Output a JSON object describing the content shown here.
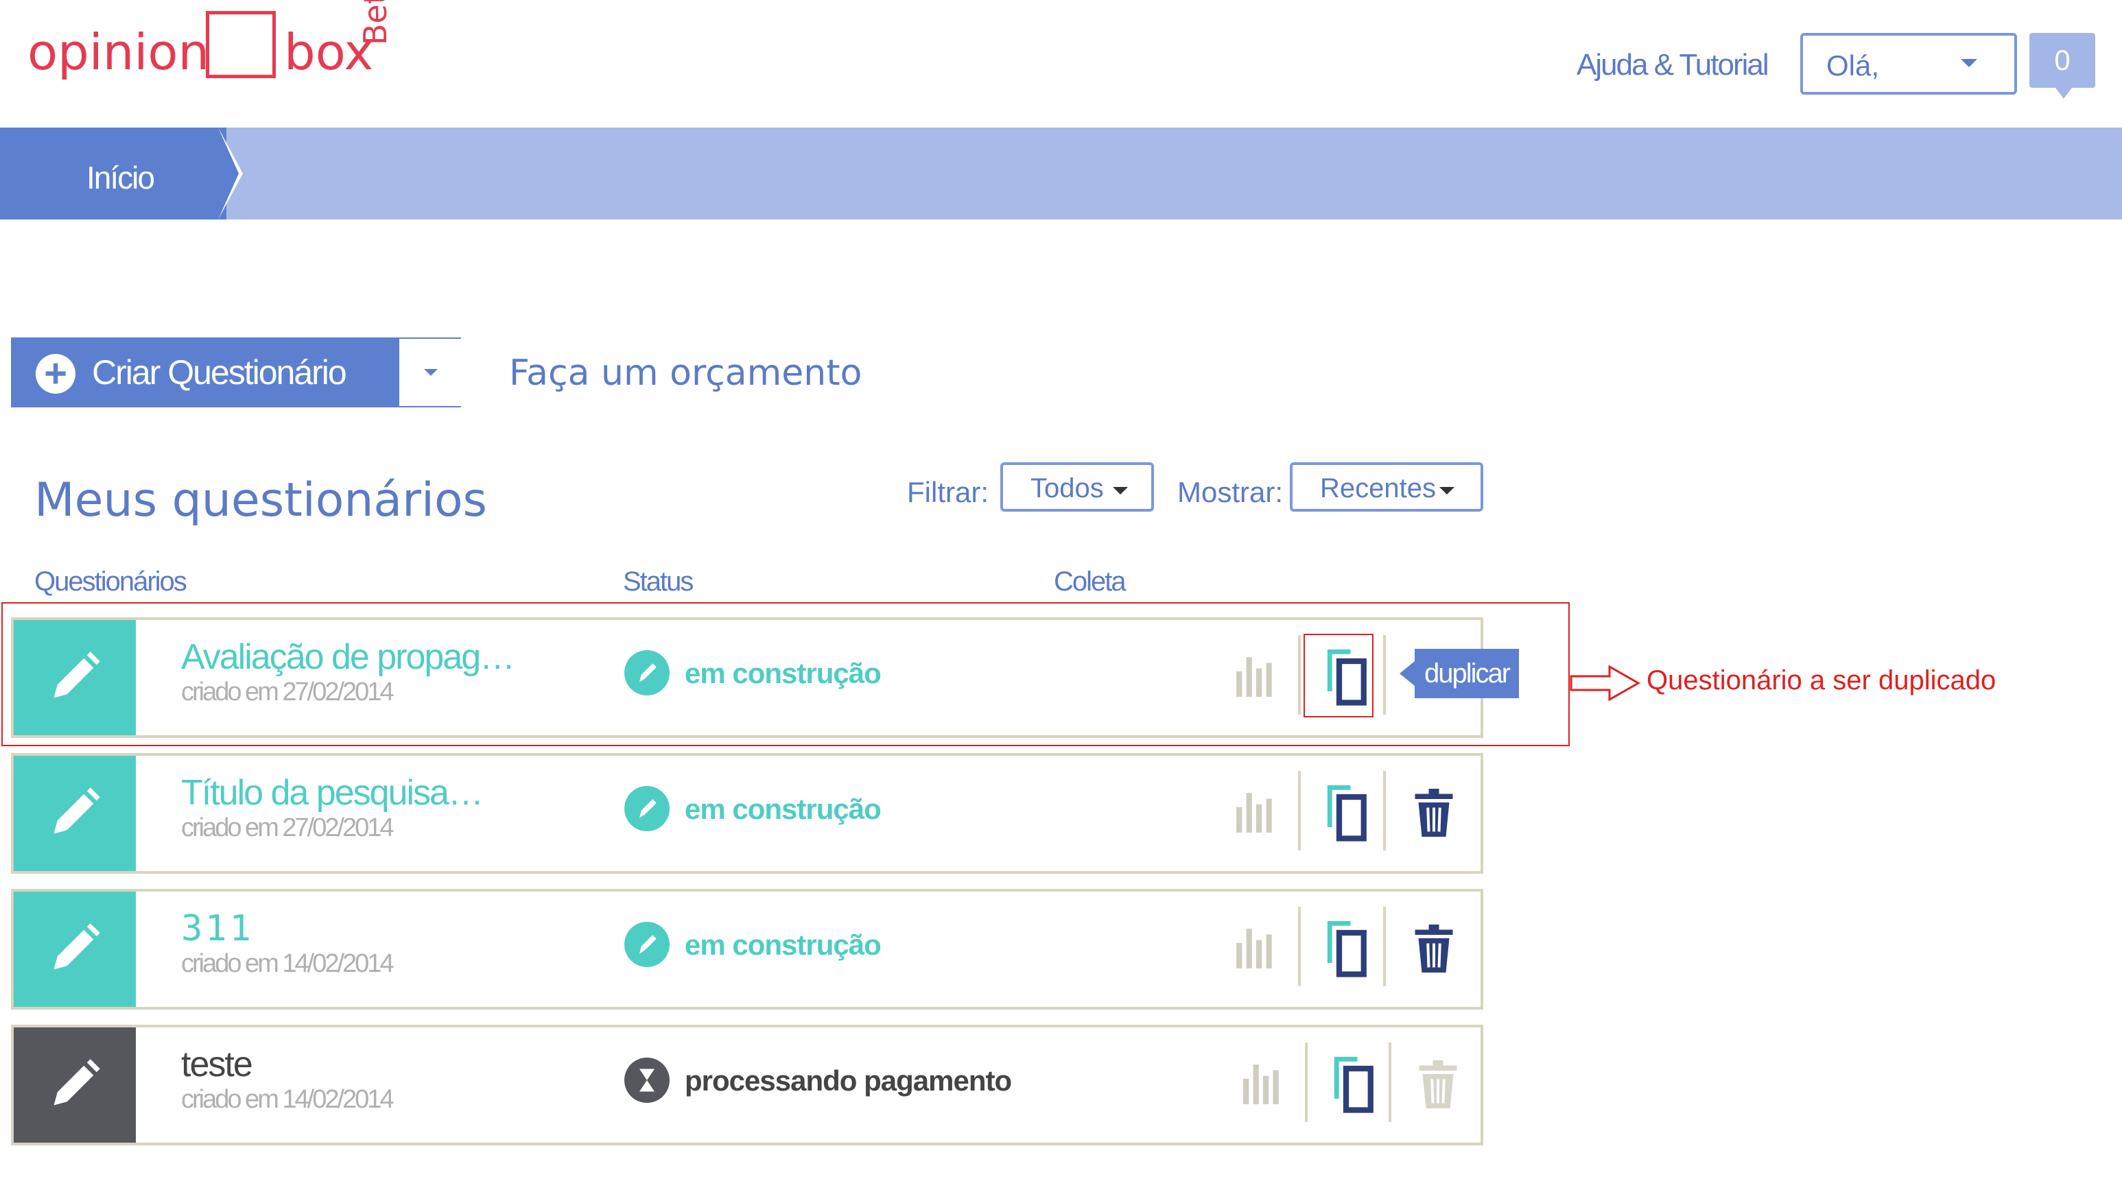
{
  "header": {
    "logo_left": "opinion",
    "logo_right": "box",
    "logo_beta": "Beta",
    "help_link": "Ajuda & Tutorial",
    "user_greeting": "Olá,",
    "notification_count": "0"
  },
  "breadcrumb": {
    "home": "Início"
  },
  "actions": {
    "create_label": "Criar Questionário",
    "budget_link": "Faça um orçamento"
  },
  "page_title": "Meus questionários",
  "filters": {
    "filter_label": "Filtrar:",
    "filter_value": "Todos",
    "show_label": "Mostrar:",
    "show_value": "Recentes"
  },
  "columns": {
    "questionnaires": "Questionários",
    "status": "Status",
    "collection": "Coleta"
  },
  "rows": [
    {
      "title": "Avaliação de propag…",
      "date": "criado em 27/02/2014",
      "status": "em construção"
    },
    {
      "title": "Título da pesquisa…",
      "date": "criado em 27/02/2014",
      "status": "em construção"
    },
    {
      "title": "311",
      "date": "criado em 14/02/2014",
      "status": "em construção"
    },
    {
      "title": "teste",
      "date": "criado em 14/02/2014",
      "status": "processando pagamento"
    }
  ],
  "tooltip": "duplicar",
  "annotation": "Questionário a ser duplicado",
  "colors": {
    "brand": "#e53b50",
    "primary": "#5c80cf",
    "teal": "#4ecdc4",
    "dark": "#55575c",
    "annotation": "#e02020"
  }
}
